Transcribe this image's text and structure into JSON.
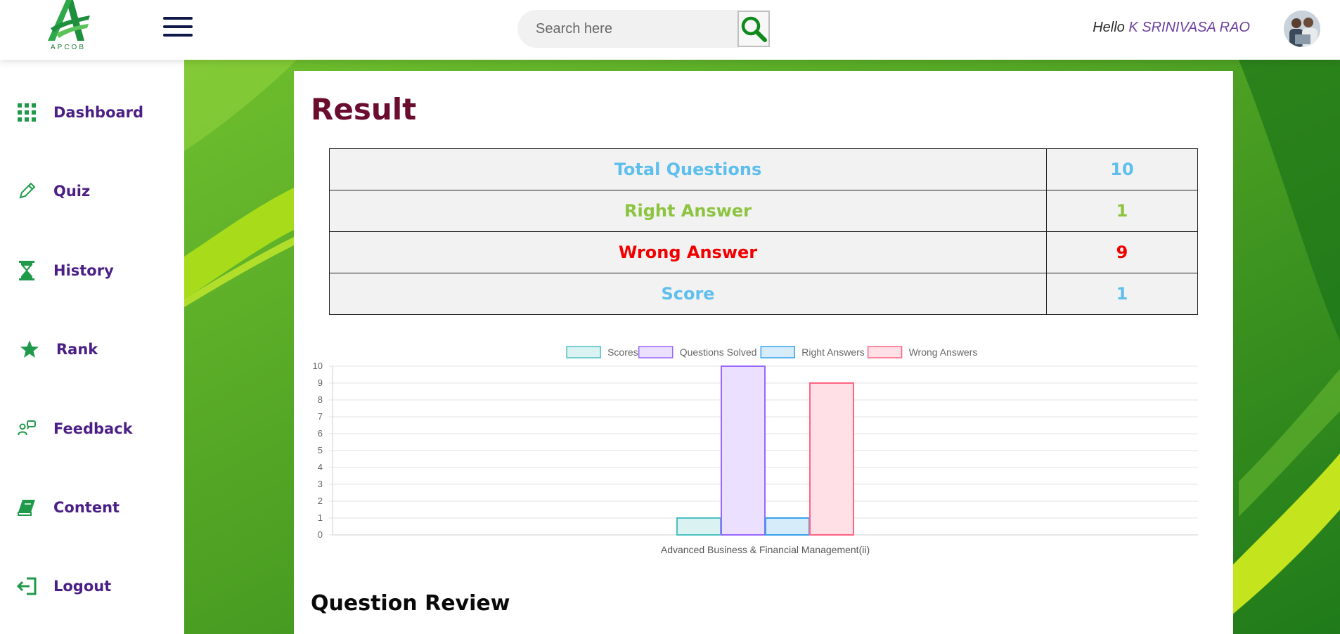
{
  "header": {
    "logo_text": "APCOB",
    "search_placeholder": "Search here",
    "greeting": "Hello",
    "user_name": "K SRINIVASA RAO"
  },
  "sidebar": {
    "items": [
      {
        "label": "Dashboard",
        "icon": "grid-icon"
      },
      {
        "label": "Quiz",
        "icon": "pencil-icon"
      },
      {
        "label": "History",
        "icon": "hourglass-icon"
      },
      {
        "label": "Rank",
        "icon": "star-icon"
      },
      {
        "label": "Feedback",
        "icon": "chat-icon"
      },
      {
        "label": "Content",
        "icon": "book-icon"
      },
      {
        "label": "Logout",
        "icon": "logout-icon"
      }
    ]
  },
  "main": {
    "title": "Result",
    "summary": [
      {
        "label": "Total Questions",
        "value": "10",
        "color": "#5fbfec"
      },
      {
        "label": "Right Answer",
        "value": "1",
        "color": "#8cc43f"
      },
      {
        "label": "Wrong Answer",
        "value": "9",
        "color": "#f20000"
      },
      {
        "label": "Score",
        "value": "1",
        "color": "#5fbfec"
      }
    ],
    "review_title": "Question Review"
  },
  "colors": {
    "brand_green": "#2e8a1e",
    "nav_text": "#4b1f85",
    "title": "#6a0d2e"
  },
  "chart_data": {
    "type": "bar",
    "categories": [
      "Advanced Business & Financial Management(ii)"
    ],
    "series": [
      {
        "name": "Scores",
        "values": [
          1
        ],
        "border": "#4bc0c0",
        "fill": "#dbf2f2"
      },
      {
        "name": "Questions Solved",
        "values": [
          10
        ],
        "border": "#9966ff",
        "fill": "#ebe0ff"
      },
      {
        "name": "Right Answers",
        "values": [
          1
        ],
        "border": "#36a2eb",
        "fill": "#d7ecfb"
      },
      {
        "name": "Wrong Answers",
        "values": [
          9
        ],
        "border": "#ff6384",
        "fill": "#ffe0e6"
      }
    ],
    "ylim": [
      0,
      10
    ],
    "yticks": [
      0,
      1,
      2,
      3,
      4,
      5,
      6,
      7,
      8,
      9,
      10
    ],
    "legend_position": "top",
    "grid": true
  }
}
